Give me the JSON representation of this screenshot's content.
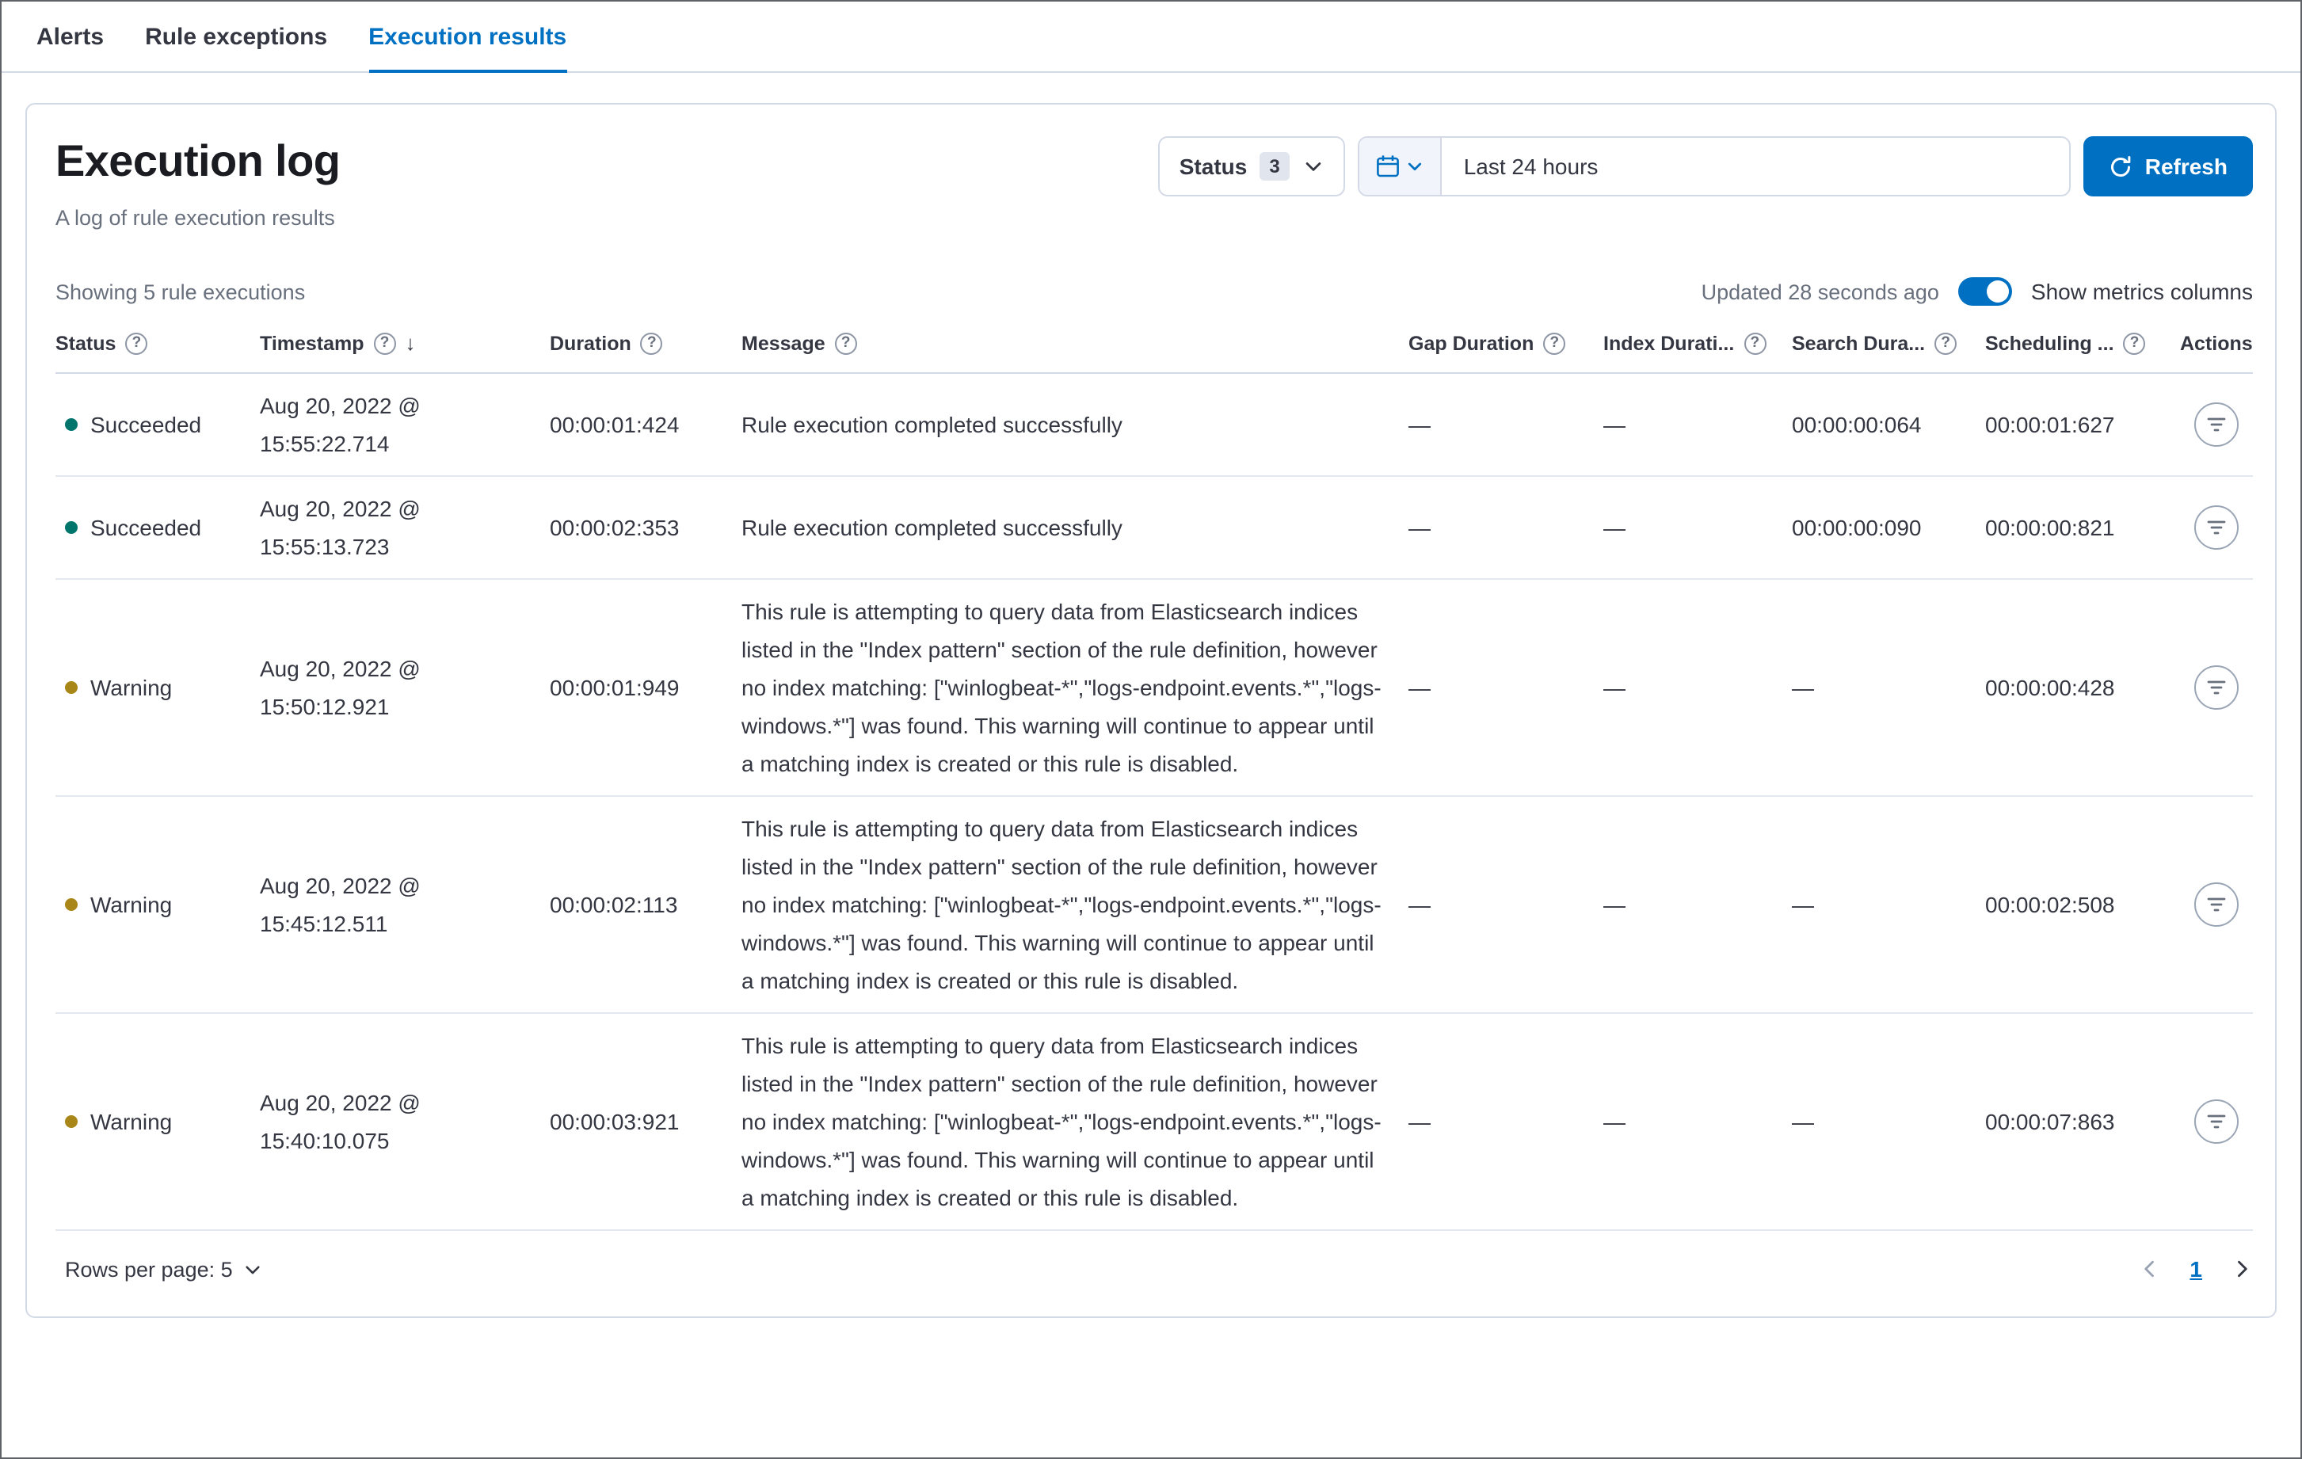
{
  "tabs": [
    {
      "label": "Alerts",
      "active": false
    },
    {
      "label": "Rule exceptions",
      "active": false
    },
    {
      "label": "Execution results",
      "active": true
    }
  ],
  "panel": {
    "title": "Execution log",
    "subtitle": "A log of rule execution results",
    "status_filter": {
      "label": "Status",
      "count": "3"
    },
    "date_picker": {
      "value": "Last 24 hours"
    },
    "refresh_label": "Refresh",
    "showing_text": "Showing 5 rule executions",
    "updated_text": "Updated 28 seconds ago",
    "metrics_toggle": {
      "label": "Show metrics columns",
      "on": true
    }
  },
  "icons": {
    "help": "?",
    "sort_desc": "↓"
  },
  "table": {
    "columns": {
      "status": "Status",
      "timestamp": "Timestamp",
      "duration": "Duration",
      "message": "Message",
      "gap_duration": "Gap Duration",
      "index_duration": "Index Durati...",
      "search_duration": "Search Dura...",
      "scheduling_delay": "Scheduling ...",
      "actions": "Actions"
    },
    "rows": [
      {
        "status": "Succeeded",
        "timestamp": "Aug 20, 2022 @ 15:55:22.714",
        "duration": "00:00:01:424",
        "message": "Rule execution completed successfully",
        "gap_duration": "—",
        "index_duration": "—",
        "search_duration": "00:00:00:064",
        "scheduling_delay": "00:00:01:627"
      },
      {
        "status": "Succeeded",
        "timestamp": "Aug 20, 2022 @ 15:55:13.723",
        "duration": "00:00:02:353",
        "message": "Rule execution completed successfully",
        "gap_duration": "—",
        "index_duration": "—",
        "search_duration": "00:00:00:090",
        "scheduling_delay": "00:00:00:821"
      },
      {
        "status": "Warning",
        "timestamp": "Aug 20, 2022 @ 15:50:12.921",
        "duration": "00:00:01:949",
        "message": "This rule is attempting to query data from Elasticsearch indices listed in the \"Index pattern\" section of the rule definition, however no index matching: [\"winlogbeat-*\",\"logs-endpoint.events.*\",\"logs-windows.*\"] was found. This warning will continue to appear until a matching index is created or this rule is disabled.",
        "gap_duration": "—",
        "index_duration": "—",
        "search_duration": "—",
        "scheduling_delay": "00:00:00:428"
      },
      {
        "status": "Warning",
        "timestamp": "Aug 20, 2022 @ 15:45:12.511",
        "duration": "00:00:02:113",
        "message": "This rule is attempting to query data from Elasticsearch indices listed in the \"Index pattern\" section of the rule definition, however no index matching: [\"winlogbeat-*\",\"logs-endpoint.events.*\",\"logs-windows.*\"] was found. This warning will continue to appear until a matching index is created or this rule is disabled.",
        "gap_duration": "—",
        "index_duration": "—",
        "search_duration": "—",
        "scheduling_delay": "00:00:02:508"
      },
      {
        "status": "Warning",
        "timestamp": "Aug 20, 2022 @ 15:40:10.075",
        "duration": "00:00:03:921",
        "message": "This rule is attempting to query data from Elasticsearch indices listed in the \"Index pattern\" section of the rule definition, however no index matching: [\"winlogbeat-*\",\"logs-endpoint.events.*\",\"logs-windows.*\"] was found. This warning will continue to appear until a matching index is created or this rule is disabled.",
        "gap_duration": "—",
        "index_duration": "—",
        "search_duration": "—",
        "scheduling_delay": "00:00:07:863"
      }
    ]
  },
  "footer": {
    "rows_per_page": "Rows per page: 5",
    "page": "1"
  },
  "colors": {
    "accent": "#0071c2",
    "success_dot": "#00756b",
    "warning_dot": "#a98618",
    "border": "#d3dae6",
    "text": "#343741",
    "subdued": "#69707d"
  }
}
